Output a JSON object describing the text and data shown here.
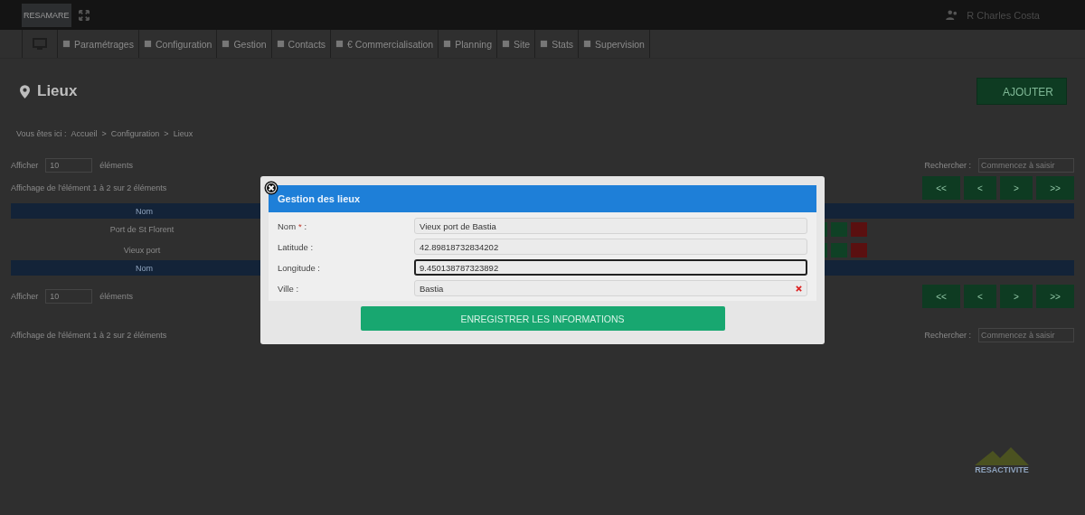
{
  "topbar": {
    "logo": "RESAMARE",
    "user": "R Charles Costa"
  },
  "nav": [
    {
      "kind": "icon"
    },
    {
      "kind": "text",
      "label": "Paramétrages"
    },
    {
      "kind": "text",
      "label": "Configuration"
    },
    {
      "kind": "text",
      "label": "Gestion"
    },
    {
      "kind": "text",
      "label": "Contacts"
    },
    {
      "kind": "text",
      "label": "€ Commercialisation"
    },
    {
      "kind": "text",
      "label": "Planning"
    },
    {
      "kind": "text",
      "label": "Site"
    },
    {
      "kind": "text",
      "label": "Stats"
    },
    {
      "kind": "text",
      "label": "Supervision"
    }
  ],
  "page": {
    "title": "Lieux",
    "add_button": "AJOUTER",
    "breadcrumb": [
      "Vous êtes ici :",
      "Accueil",
      ">",
      "Configuration",
      ">",
      "Lieux"
    ]
  },
  "table_top": {
    "show_label": "Afficher",
    "show_value": "10",
    "show_unit": "éléments",
    "search_label": "Rechercher :",
    "search_placeholder": "Commencez à saisir",
    "info": "Affichage de l'élément 1 à 2 sur 2 éléments"
  },
  "table": {
    "columns": [
      "Nom"
    ],
    "footer_columns": [
      "Nom"
    ],
    "rows": [
      {
        "name": "Port de St Florent"
      },
      {
        "name": "Vieux port"
      }
    ]
  },
  "pagination": [
    "<<",
    "<",
    ">",
    ">>"
  ],
  "table_bottom": {
    "show_label": "Afficher",
    "show_value": "10",
    "show_unit": "éléments",
    "search_label": "Rechercher :",
    "search_placeholder": "Commencez à saisir",
    "info": "Affichage de l'élément 1 à 2 sur 2 éléments"
  },
  "footer_logo": "RESACTIVITE",
  "modal": {
    "title": "Gestion des lieux",
    "submit": "ENREGISTRER LES INFORMATIONS",
    "fields": [
      {
        "label": "Nom",
        "required_mark": "*",
        "label_end": " :",
        "value": "Vieux port de Bastia",
        "focused": false,
        "clearable": false
      },
      {
        "label": "Latitude :",
        "value": "42.89818732834202",
        "focused": false,
        "clearable": false
      },
      {
        "label": "Longitude :",
        "value": "9.450138787323892",
        "focused": true,
        "clearable": false
      },
      {
        "label": "Ville :",
        "value": "Bastia",
        "focused": false,
        "clearable": true
      }
    ]
  }
}
